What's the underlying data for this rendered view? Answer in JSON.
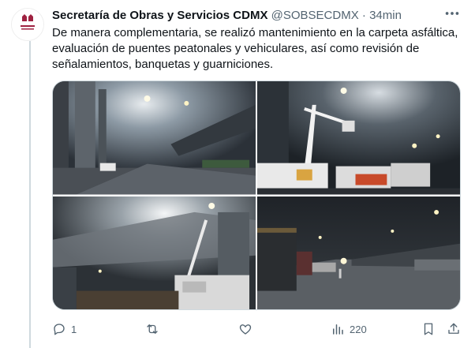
{
  "tweet": {
    "author_name": "Secretaría de Obras y Servicios CDMX",
    "author_handle": "@SOBSECDMX",
    "separator": "·",
    "time_ago": "34min",
    "text": "De manera complementaria, se realizó mantenimiento en la carpeta asfáltica, evaluación de puentes peatonales y vehiculares, así como revisión de señalamientos, banquetas y guarniciones."
  },
  "avatar": {
    "label": "CIUDAD DE MÉXICO",
    "brand_color": "#9f2241"
  },
  "photos": [
    {
      "name": "photo-underpass-street"
    },
    {
      "name": "photo-crane-trucks"
    },
    {
      "name": "photo-bridge-underside"
    },
    {
      "name": "photo-night-avenue"
    }
  ],
  "actions": {
    "reply_count": "1",
    "retweet_count": "",
    "like_count": "",
    "views_count": "220"
  },
  "colors": {
    "text": "#0f1419",
    "secondary": "#536471",
    "border": "#cfd9de"
  }
}
